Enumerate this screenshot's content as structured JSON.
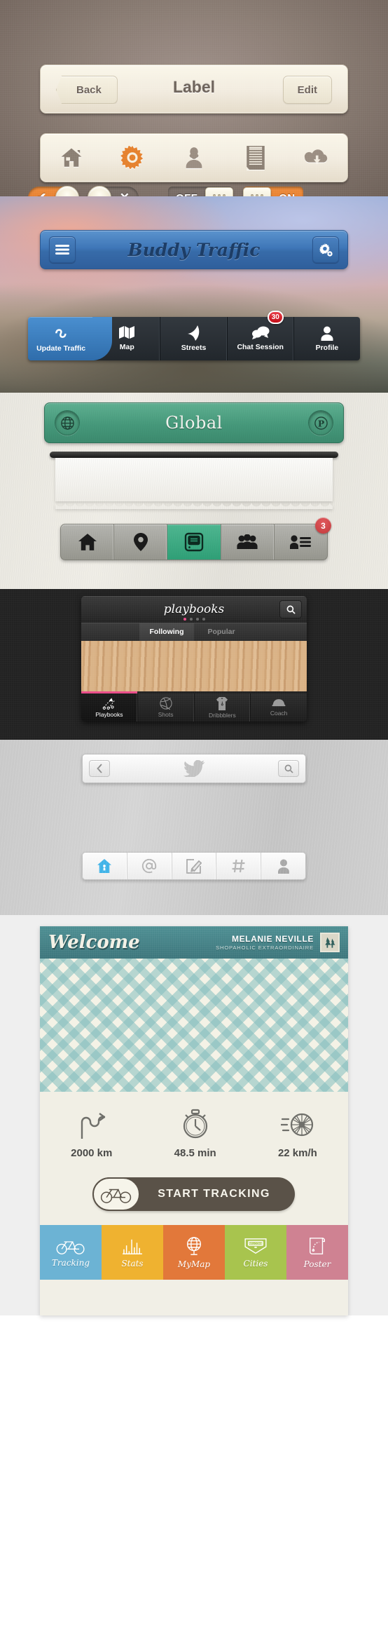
{
  "section_navbar": {
    "back_label": "Back",
    "title": "Label",
    "edit_label": "Edit",
    "toolbar_icons": [
      "home-icon",
      "gear-icon",
      "user-icon",
      "document-icon",
      "cloud-download-icon"
    ],
    "accent_color": "#e5812d",
    "toggles": [
      {
        "state": "on",
        "mark": "✔"
      },
      {
        "state": "off",
        "mark": "✕"
      }
    ],
    "switches": [
      {
        "label": "OFF",
        "state": "off"
      },
      {
        "label": "ON",
        "state": "on"
      }
    ]
  },
  "section_buddy": {
    "title": "Buddy Traffic",
    "menu_icon": "hamburger-icon",
    "settings_icon": "gear-icon",
    "accent_color": "#3f77b8",
    "tabs": [
      {
        "label": "Update Traffic",
        "icon": "refresh-icon",
        "active": true,
        "badge": ""
      },
      {
        "label": "Map",
        "icon": "map-icon",
        "active": false,
        "badge": ""
      },
      {
        "label": "Streets",
        "icon": "road-icon",
        "active": false,
        "badge": ""
      },
      {
        "label": "Chat Session",
        "icon": "chat-bubbles-icon",
        "active": false,
        "badge": "30"
      },
      {
        "label": "Profile",
        "icon": "person-icon",
        "active": false,
        "badge": ""
      }
    ]
  },
  "section_global": {
    "title": "Global",
    "left_icon": "globe-icon",
    "right_icon": "parking-p-icon",
    "accent_color": "#46997b",
    "tabs": [
      {
        "icon": "home-icon",
        "active": false,
        "badge": ""
      },
      {
        "icon": "map-pin-icon",
        "active": false,
        "badge": ""
      },
      {
        "icon": "screen-icon",
        "active": true,
        "badge": ""
      },
      {
        "icon": "group-icon",
        "active": false,
        "badge": ""
      },
      {
        "icon": "contact-list-icon",
        "active": false,
        "badge": "3"
      }
    ]
  },
  "section_playbooks": {
    "logo": "playbooks",
    "search_icon": "search-icon",
    "page_dots": 4,
    "active_dot": 0,
    "accent_color": "#ea4c89",
    "segments": [
      {
        "label": "Following",
        "active": true
      },
      {
        "label": "Popular",
        "active": false
      }
    ],
    "tabs": [
      {
        "label": "Playbooks",
        "icon": "play-diagram-icon",
        "active": true
      },
      {
        "label": "Shots",
        "icon": "basketball-icon",
        "active": false
      },
      {
        "label": "Dribbblers",
        "icon": "jersey-icon",
        "active": false
      },
      {
        "label": "Coach",
        "icon": "cap-icon",
        "active": false
      }
    ]
  },
  "section_twitter": {
    "back_icon": "chevron-left-icon",
    "brand_icon": "twitter-bird-icon",
    "search_icon": "search-icon",
    "accent_color": "#3fb3e8",
    "tabs": [
      {
        "icon": "home-icon",
        "active": true
      },
      {
        "icon": "at-mention-icon",
        "active": false
      },
      {
        "icon": "compose-icon",
        "active": false
      },
      {
        "icon": "hashtag-icon",
        "active": false
      },
      {
        "icon": "person-icon",
        "active": false
      }
    ]
  },
  "section_cycling": {
    "welcome": "Welcome",
    "user_name": "MELANIE NEVILLE",
    "user_subtitle": "SHOPAHOLIC EXTRAORDINAIRE",
    "avatar_icon": "trees-icon",
    "header_color": "#45838a",
    "stats": [
      {
        "icon": "route-icon",
        "value": "2000 km"
      },
      {
        "icon": "stopwatch-icon",
        "value": "48.5 min"
      },
      {
        "icon": "wheel-speed-icon",
        "value": "22 km/h"
      }
    ],
    "cta": {
      "label": "START TRACKING",
      "icon": "bicycle-icon"
    },
    "nav": [
      {
        "label": "Tracking",
        "icon": "bicycle-icon",
        "color": "#6cb3d4"
      },
      {
        "label": "Stats",
        "icon": "bar-chart-icon",
        "color": "#efb230"
      },
      {
        "label": "MyMap",
        "icon": "globe-stand-icon",
        "color": "#e2783a"
      },
      {
        "label": "Cities",
        "icon": "welcome-badge-icon",
        "color": "#a8c44e"
      },
      {
        "label": "Poster",
        "icon": "scroll-icon",
        "color": "#cf8292"
      }
    ]
  }
}
